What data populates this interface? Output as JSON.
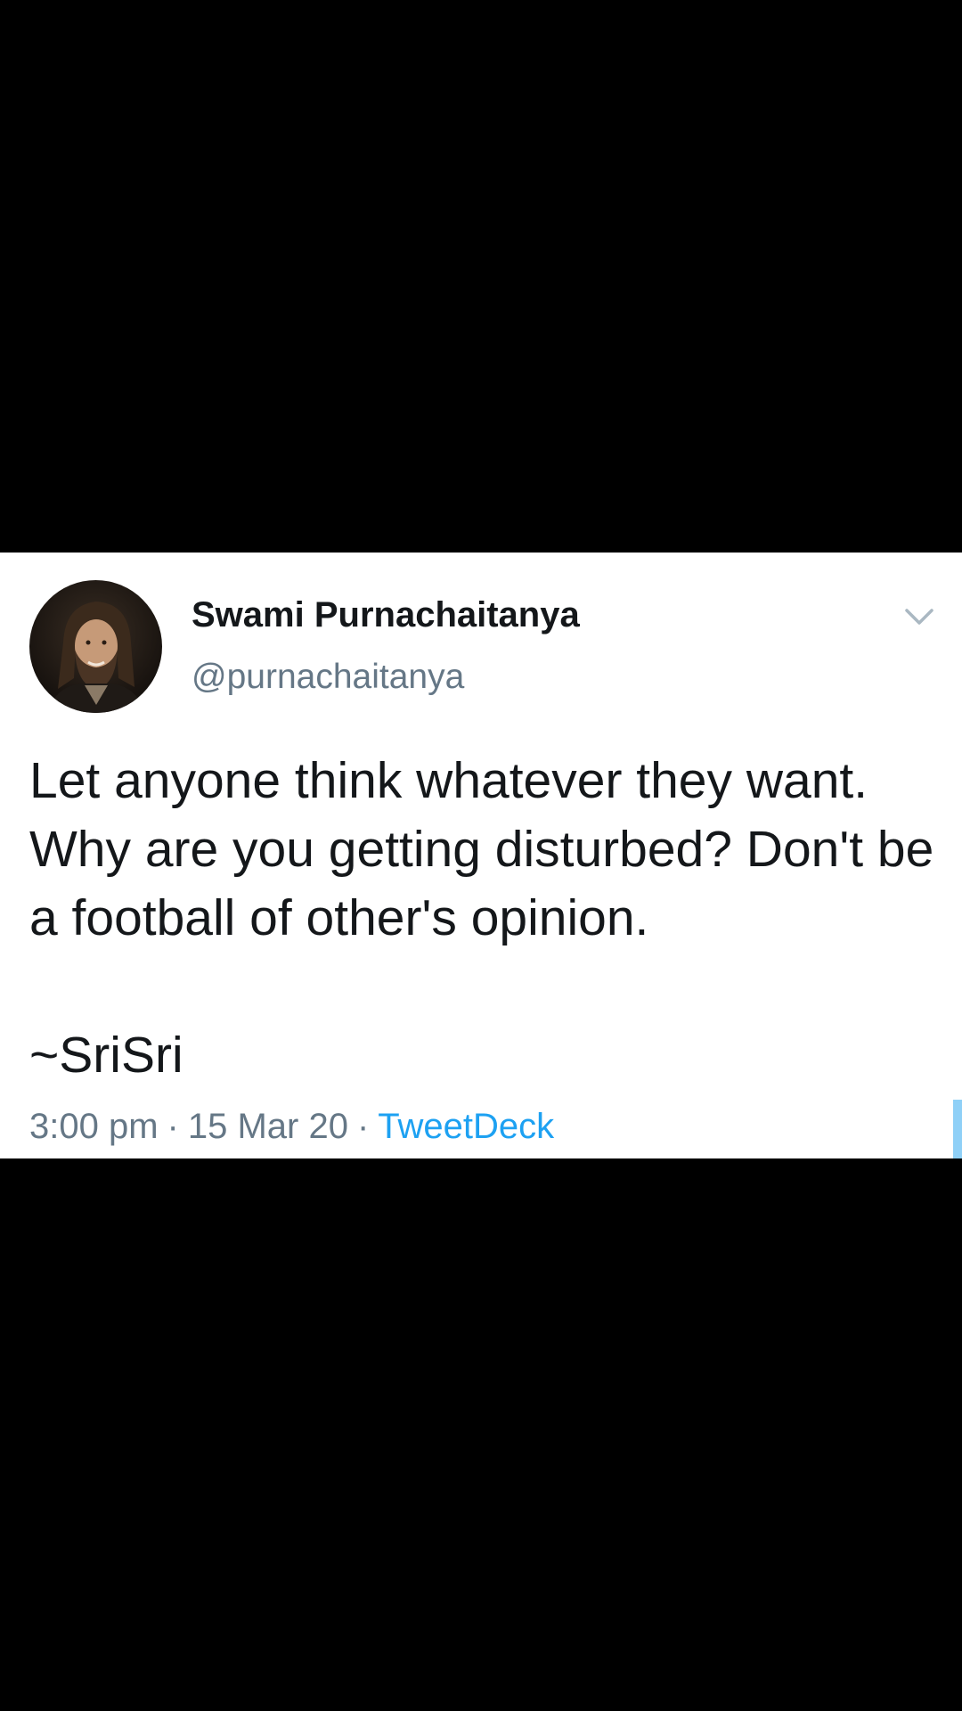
{
  "tweet": {
    "author": {
      "display_name": "Swami Purnachaitanya",
      "handle": "@purnachaitanya",
      "avatar": "author-avatar-photo"
    },
    "text": "Let anyone think whatever they want. Why are you getting disturbed? Don't be a football of other's opinion.\n\n~SriSri",
    "time": "3:00 pm",
    "separator": "·",
    "date": "15 Mar 20",
    "source": "TweetDeck",
    "menu_icon": "chevron-down-icon"
  },
  "colors": {
    "background": "#000000",
    "card": "#ffffff",
    "text": "#14171a",
    "secondary_text": "#657786",
    "link": "#1da1f2"
  }
}
